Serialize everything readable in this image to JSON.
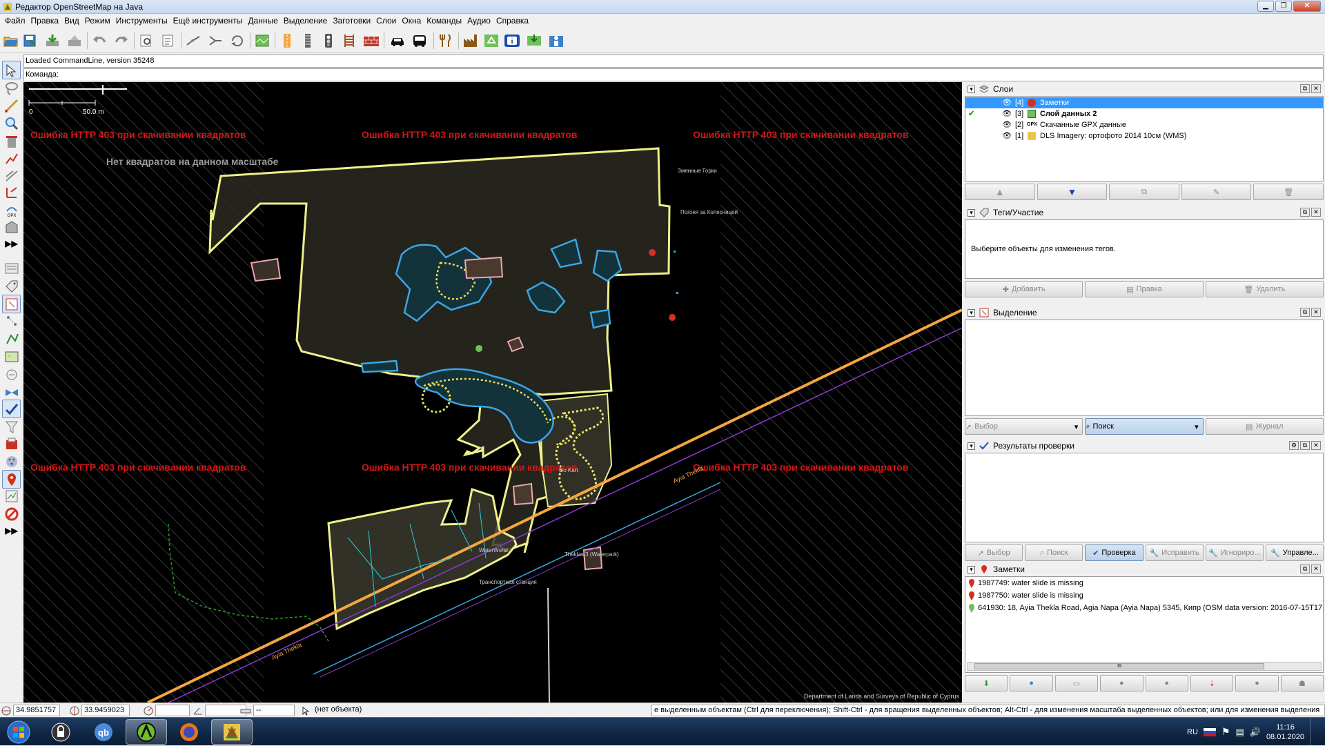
{
  "window": {
    "title": "Редактор OpenStreetMap на Java",
    "controls": [
      "minimize",
      "maximize",
      "close"
    ]
  },
  "menubar": {
    "items": [
      "Файл",
      "Правка",
      "Вид",
      "Режим",
      "Инструменты",
      "Ещё инструменты",
      "Данные",
      "Выделение",
      "Заготовки",
      "Слои",
      "Окна",
      "Команды",
      "Аудио",
      "Справка"
    ]
  },
  "toolbar": {
    "icons": [
      "open-file-icon",
      "save-icon",
      "download-icon",
      "upload-icon",
      "undo-icon",
      "redo-icon",
      "preferences-icon",
      "preset-search-icon",
      "split-way-icon",
      "combine-way-icon",
      "reverse-icon",
      "imagery-icon",
      "road-icon",
      "rail-icon",
      "traffic-light-icon",
      "bridge-icon",
      "wall-icon",
      "car-icon",
      "bus-icon",
      "restaurant-icon",
      "industrial-icon",
      "recycling-icon",
      "info-icon",
      "tourism-icon",
      "person-icon"
    ]
  },
  "commandline": {
    "info": "Loaded CommandLine, version 35248",
    "prompt": "Команда:"
  },
  "map": {
    "scale": {
      "zero": "0",
      "distance": "50.0 m"
    },
    "errors": [
      "Ошибка HTTP 403 при скачивании квадратов",
      "Ошибка HTTP 403 при скачивании квадратов",
      "Ошибка HTTP 403 при скачивании квадратов",
      "Ошибка HTTP 403 при скачивании квадратов",
      "Ошибка HTTP 403 при скачивании квадратов",
      "Ошибка HTTP 403 при скачивании квадратов"
    ],
    "no_tiles": "Нет квадратов на данном масштабе",
    "labels": {
      "snake_hills": "Змеиные Горки",
      "chase": "Погоня за Колесницей",
      "waterworld": "WaterWorld",
      "theklas": "Theklas 3 (Waterpark)",
      "go_kart": "Go Kart",
      "road1": "Ayia Thekla",
      "road2": "Ayia Thekla",
      "transport": "Транспортная станция"
    },
    "attribution": "Department of Lands and Surveys of Republic of Cyprus"
  },
  "panels": {
    "layers": {
      "title": "Слои",
      "items": [
        {
          "index": "[4]",
          "name": "Заметки",
          "selected": true,
          "bold": false,
          "icon": "notes-layer-icon"
        },
        {
          "index": "[3]",
          "name": "Слой данных 2",
          "selected": false,
          "bold": true,
          "icon": "data-layer-icon",
          "active": true
        },
        {
          "index": "[2]",
          "name": "Скачанные GPX данные",
          "selected": false,
          "bold": false,
          "icon": "gpx-layer-icon",
          "badge": "GPX"
        },
        {
          "index": "[1]",
          "name": "DLS Imagery: ортофото 2014 10см (WMS)",
          "selected": false,
          "bold": false,
          "icon": "imagery-layer-icon"
        }
      ],
      "buttons": [
        "move-up",
        "move-down",
        "merge",
        "duplicate",
        "delete"
      ]
    },
    "tags": {
      "title": "Теги/Участие",
      "placeholder": "Выберите объекты для изменения тегов.",
      "buttons": [
        "Добавить",
        "Правка",
        "Удалить"
      ]
    },
    "selection": {
      "title": "Выделение",
      "buttons": [
        "Выбор",
        "Поиск",
        "Журнал"
      ]
    },
    "validation": {
      "title": "Результаты проверки",
      "buttons": [
        "Выбор",
        "Поиск",
        "Проверка",
        "Исправить",
        "Игнориро...",
        "Управле..."
      ]
    },
    "notes": {
      "title": "Заметки",
      "items": [
        {
          "text": "1987749: water slide is missing",
          "status": "open"
        },
        {
          "text": "1987750: water slide is missing",
          "status": "open"
        },
        {
          "text": "641930: 18, Ayia Thekla Road, Agia Napa (Ayia Napa) 5345, Кипр (OSM data version: 2016-07-15T17",
          "status": "closed"
        }
      ],
      "scrollbar_thumb": "III"
    }
  },
  "statusbar": {
    "lat": "34.9851757",
    "lon": "33.9459023",
    "heading": "",
    "angle": "",
    "distance": "--",
    "object": "(нет объекта)",
    "help": "е выделенным объектам (Ctrl для переключения); Shift-Ctrl - для вращения выделенных объектов; Alt-Ctrl - для изменения масштаба выделенных объектов; или для изменения выделения"
  },
  "taskbar": {
    "apps": [
      "start-button",
      "keepass",
      "qbittorrent",
      "josm-alt",
      "firefox",
      "josm"
    ],
    "language": "RU",
    "time": "11:16",
    "date": "08.01.2020"
  },
  "colors": {
    "map_bg": "#000000",
    "error_text": "#d21717",
    "area_outline": "#f3f08a",
    "water": "#3aa6e6",
    "road": "#f4a640",
    "selection": "#3399ff"
  }
}
